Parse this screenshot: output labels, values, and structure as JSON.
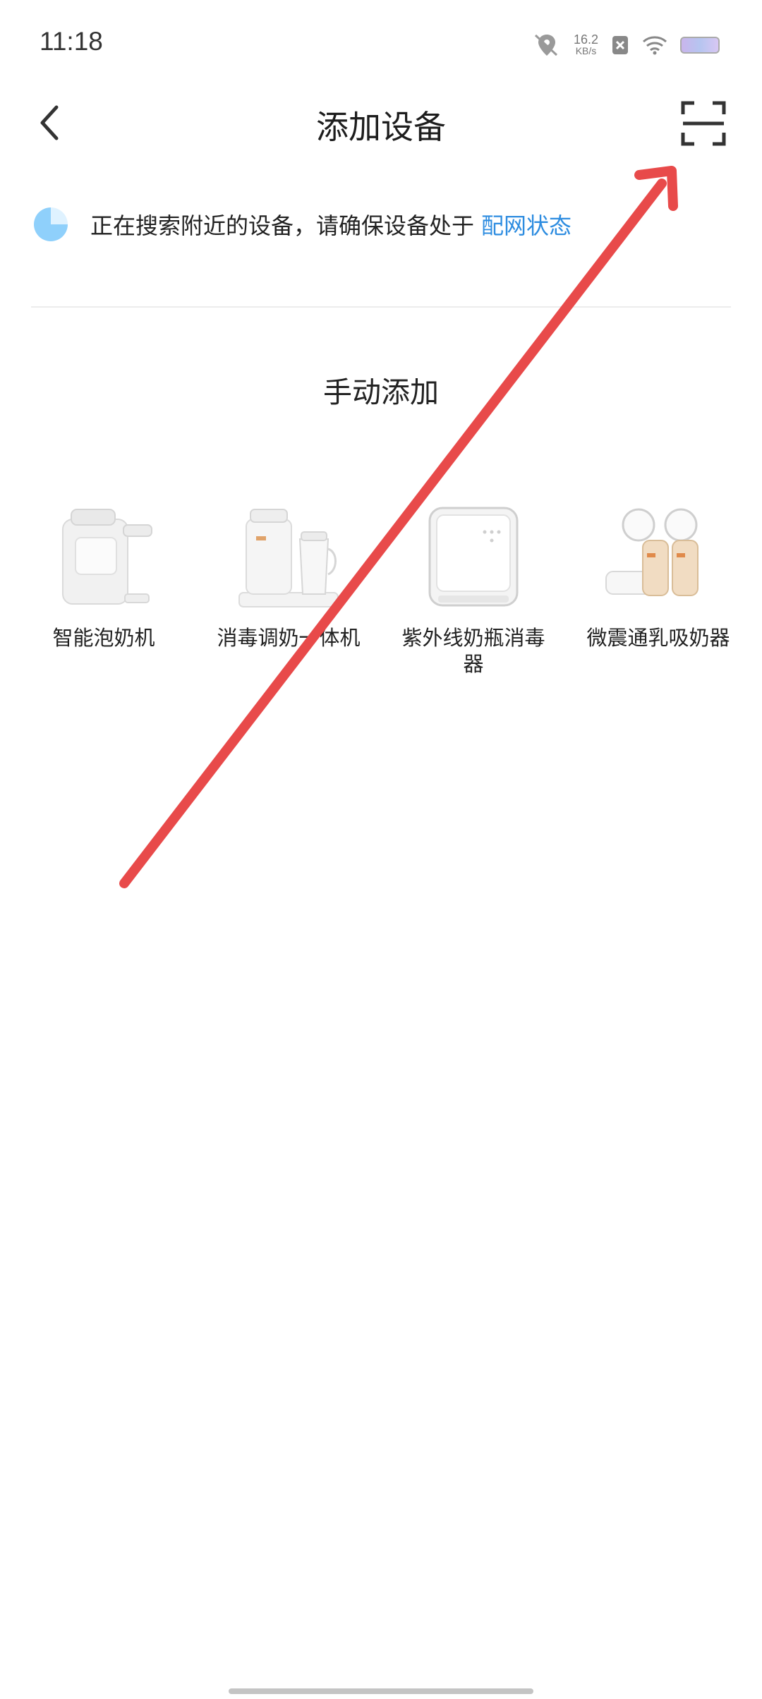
{
  "status_bar": {
    "time": "11:18",
    "net_speed_value": "16.2",
    "net_speed_unit": "KB/s",
    "icons": [
      "location-off-icon",
      "sim-off-icon",
      "wifi-icon",
      "battery-icon"
    ]
  },
  "header": {
    "title": "添加设备",
    "back_icon": "chevron-left-icon",
    "scan_icon": "scan-icon"
  },
  "search": {
    "status_text": "正在搜索附近的设备，请确保设备处于",
    "link_text": "配网状态",
    "link_color": "#2d8ce0"
  },
  "manual_add": {
    "title": "手动添加",
    "devices": [
      {
        "name": "智能泡奶机",
        "icon": "formula-machine-icon"
      },
      {
        "name": "消毒调奶一体机",
        "icon": "sterilizer-kettle-icon"
      },
      {
        "name": "紫外线奶瓶消毒器",
        "icon": "uv-sterilizer-icon"
      },
      {
        "name": "微震通乳吸奶器",
        "icon": "breast-pump-icon"
      }
    ]
  },
  "annotation": {
    "color": "#e84a4a"
  }
}
